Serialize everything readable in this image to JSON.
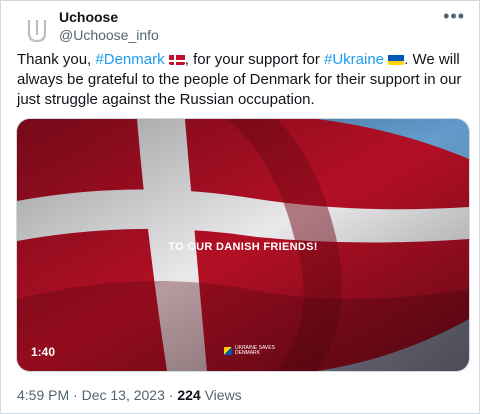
{
  "author": {
    "name": "Uchoose",
    "handle": "@Uchoose_info",
    "avatar_icon": "uchoose-logo-icon"
  },
  "more_label": "•••",
  "tweet": {
    "part1": "Thank you, ",
    "tag_denmark": "#Denmark",
    "part2": ", for your support for ",
    "tag_ukraine": "#Ukraine",
    "part3": ". We will always be grateful to the people of Denmark for their support in our just struggle against the Russian occupation."
  },
  "video": {
    "overlay_text": "TO OUR DANISH FRIENDS!",
    "duration": "1:40",
    "logo_line1": "UKRAINE SAVES",
    "logo_line2": "DENMARK",
    "colors": {
      "flag_red": "#c8102e",
      "flag_white": "#ffffff",
      "sky": "#7fb3d8"
    }
  },
  "meta": {
    "time": "4:59 PM",
    "separator": " · ",
    "date": "Dec 13, 2023",
    "views_count": "224",
    "views_label": " Views"
  }
}
